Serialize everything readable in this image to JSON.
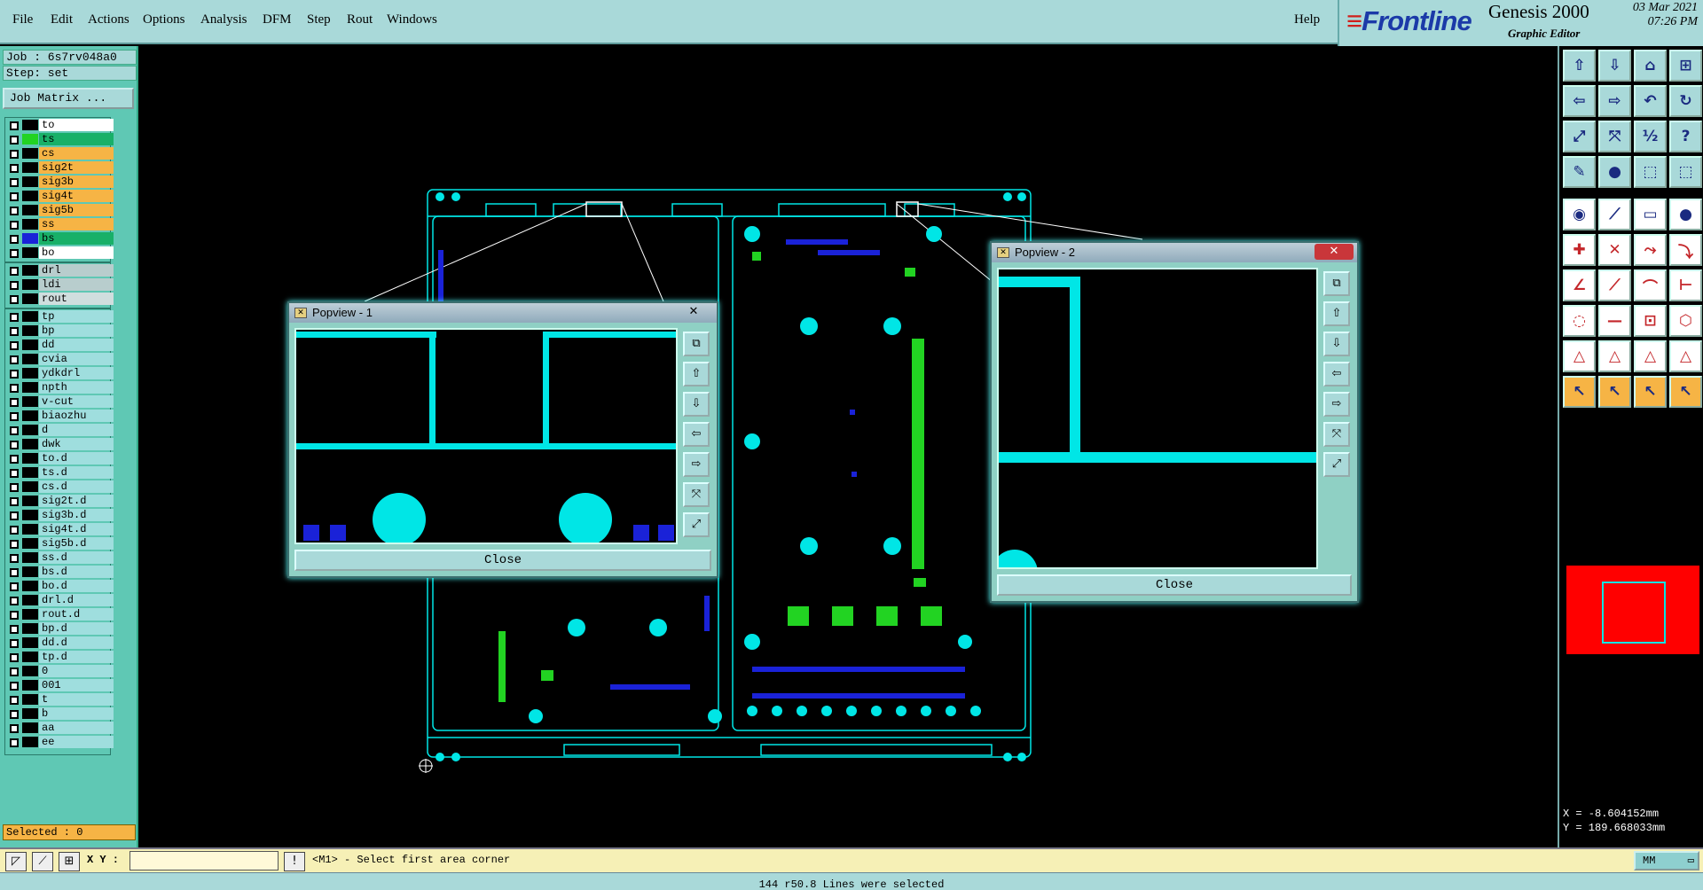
{
  "menu": {
    "items": [
      "File",
      "Edit",
      "Actions",
      "Options",
      "Analysis",
      "DFM",
      "Step",
      "Rout",
      "Windows"
    ],
    "help": "Help"
  },
  "brand": {
    "logo": "Frontline",
    "title": "Genesis 2000",
    "subtitle": "Graphic Editor",
    "date": "03 Mar 2021",
    "time": "07:26 PM"
  },
  "job": {
    "job_line": "Job : 6s7rv048a0",
    "step_line": "Step: set",
    "matrix_button": "Job Matrix ..."
  },
  "layers": {
    "group1": [
      {
        "name": "to",
        "bg": "#ffffff",
        "color": "#000000"
      },
      {
        "name": "ts",
        "bg": "#18b068",
        "color": "#22d322"
      },
      {
        "name": "cs",
        "bg": "#f6b445",
        "color": "#000000"
      },
      {
        "name": "sig2t",
        "bg": "#f6b445",
        "color": "#000000"
      },
      {
        "name": "sig3b",
        "bg": "#f6b445",
        "color": "#000000"
      },
      {
        "name": "sig4t",
        "bg": "#f6b445",
        "color": "#000000"
      },
      {
        "name": "sig5b",
        "bg": "#f6b445",
        "color": "#000000"
      },
      {
        "name": "ss",
        "bg": "#f6b445",
        "color": "#000000"
      },
      {
        "name": "bs",
        "bg": "#18b068",
        "color": "#1a22d8"
      },
      {
        "name": "bo",
        "bg": "#ffffff",
        "color": "#000000"
      }
    ],
    "group2": [
      {
        "name": "drl",
        "bg": "#b8cdcd",
        "color": "#000000"
      },
      {
        "name": "ldi",
        "bg": "#b8cdcd",
        "color": "#000000"
      },
      {
        "name": "rout",
        "bg": "#d0dede",
        "color": "#000000"
      }
    ],
    "group3": [
      "tp",
      "bp",
      "dd",
      "cvia",
      "ydkdrl",
      "npth",
      "v-cut",
      "biaozhu",
      "d",
      "dwk",
      "to.d",
      "ts.d",
      "cs.d",
      "sig2t.d",
      "sig3b.d",
      "sig4t.d",
      "sig5b.d",
      "ss.d",
      "bs.d",
      "bo.d",
      "drl.d",
      "rout.d",
      "bp.d",
      "dd.d",
      "tp.d",
      "0",
      "001",
      "t",
      "b",
      "aa",
      "ee"
    ]
  },
  "selected": "Selected : 0",
  "coords": {
    "x": "X = -8.604152mm",
    "y": "Y = 189.668033mm"
  },
  "bottom": {
    "xy_label": "X Y :",
    "xy_value": "",
    "prompt": "<M1> - Select first area corner",
    "units": "MM"
  },
  "status": "144 r50.8 Lines were selected",
  "popview1": {
    "title": "Popview - 1",
    "close": "Close"
  },
  "popview2": {
    "title": "Popview - 2",
    "close": "Close"
  },
  "colors": {
    "cyan": "#00e6e6",
    "green": "#22d322",
    "blue": "#1a22d8",
    "panel": "#5fc8b4",
    "menu": "#a9d9d9"
  },
  "toolbar_icons": [
    "zoom-home-icon",
    "zoom-fit-icon",
    "home-icon",
    "window-split-icon",
    "pan-left-icon",
    "pan-right-icon",
    "undo-view-icon",
    "redraw-icon",
    "zoom-in-icon",
    "zoom-out-icon",
    "ratio-icon",
    "help-icon",
    "measure-icon",
    "probe-icon",
    "layers-red-icon",
    "layers-blue-icon",
    "pad-select-icon",
    "line-red-icon",
    "text-icon",
    "circle-icon",
    "net-icon",
    "cross-icon",
    "route-icon",
    "snap-icon",
    "angle-icon",
    "diagonal-icon",
    "arc-icon",
    "edge-icon",
    "polygon-icon",
    "line-icon",
    "box-icon",
    "contour-icon",
    "triangle-icon",
    "triangle2-icon",
    "triangle3-icon",
    "triangle4-icon",
    "pointer-icon",
    "pointer2-icon",
    "pointer3-icon",
    "pointer4-icon"
  ]
}
